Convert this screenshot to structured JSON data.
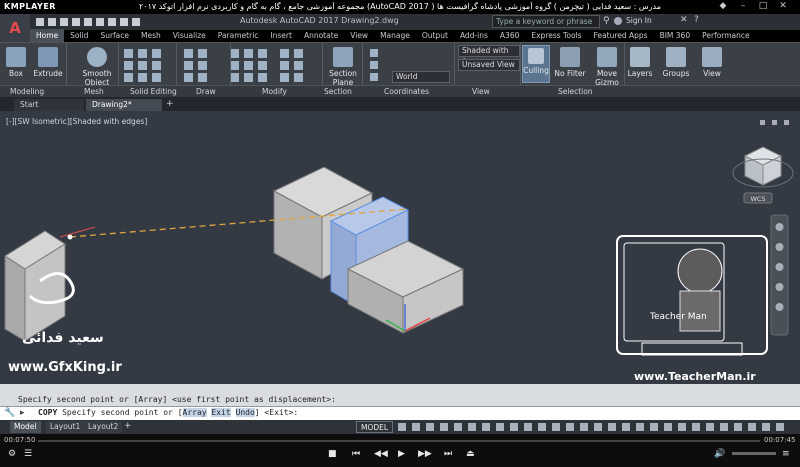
{
  "player": {
    "logo": "KMPLAYER",
    "title": "مجموعه آموزشی جامع ، گام به گام و کاربردی نرم افزار   اتوکد ۲۰۱۷ (AutoCAD 2017 )    مدرس : سعید فدایی ( تیچرمن ) گروه آموزشی پادشاه گرافیست ها",
    "time_current": "00:07:50",
    "time_total": "00:07:45"
  },
  "autocad": {
    "logo": "A",
    "app_title": "Autodesk AutoCAD 2017    Drawing2.dwg",
    "search_placeholder": "Type a keyword or phrase",
    "signin": "Sign In"
  },
  "ribbon_tabs": [
    "Home",
    "Solid",
    "Surface",
    "Mesh",
    "Visualize",
    "Parametric",
    "Insert",
    "Annotate",
    "View",
    "Manage",
    "Output",
    "Add-ins",
    "A360",
    "Express Tools",
    "Featured Apps",
    "BIM 360",
    "Performance"
  ],
  "ribbon": {
    "box": "Box",
    "extrude": "Extrude",
    "smooth_object": "Smooth Object",
    "section_plane": "Section Plane",
    "world": "World",
    "shaded_with_edges": "Shaded with e...",
    "unsaved_view": "Unsaved View",
    "culling": "Culling",
    "no_filter": "No Filter",
    "move_gizmo": "Move Gizmo",
    "layers": "Layers",
    "groups": "Groups",
    "view": "View"
  },
  "panels": [
    "Modeling",
    "Mesh",
    "Solid Editing",
    "Draw",
    "Modify",
    "Section",
    "Coordinates",
    "View",
    "Selection"
  ],
  "file_tabs": {
    "start": "Start",
    "drawing": "Drawing2*"
  },
  "viewport": {
    "label": "[-][SW Isometric][Shaded with edges]",
    "wcs": "WCS"
  },
  "command": {
    "history": "Specify second point or [Array] <use first point as displacement>:",
    "prompt_cmd": "COPY",
    "prompt_text": "Specify second point or [",
    "opt_array": "Array",
    "opt_exit": "Exit",
    "opt_undo": "Undo",
    "prompt_end": "] <Exit>:"
  },
  "status_tabs": {
    "model": "Model",
    "layout1": "Layout1",
    "layout2": "Layout2",
    "model_btn": "MODEL"
  },
  "watermarks": {
    "name": "سعید فدائی",
    "site_left": "www.GfxKing.ir",
    "site_right": "www.TeacherMan.ir",
    "tm_label": "Teacher Man"
  },
  "colors": {
    "accent": "#3d7ab8",
    "selection": "#5b8fe0"
  }
}
